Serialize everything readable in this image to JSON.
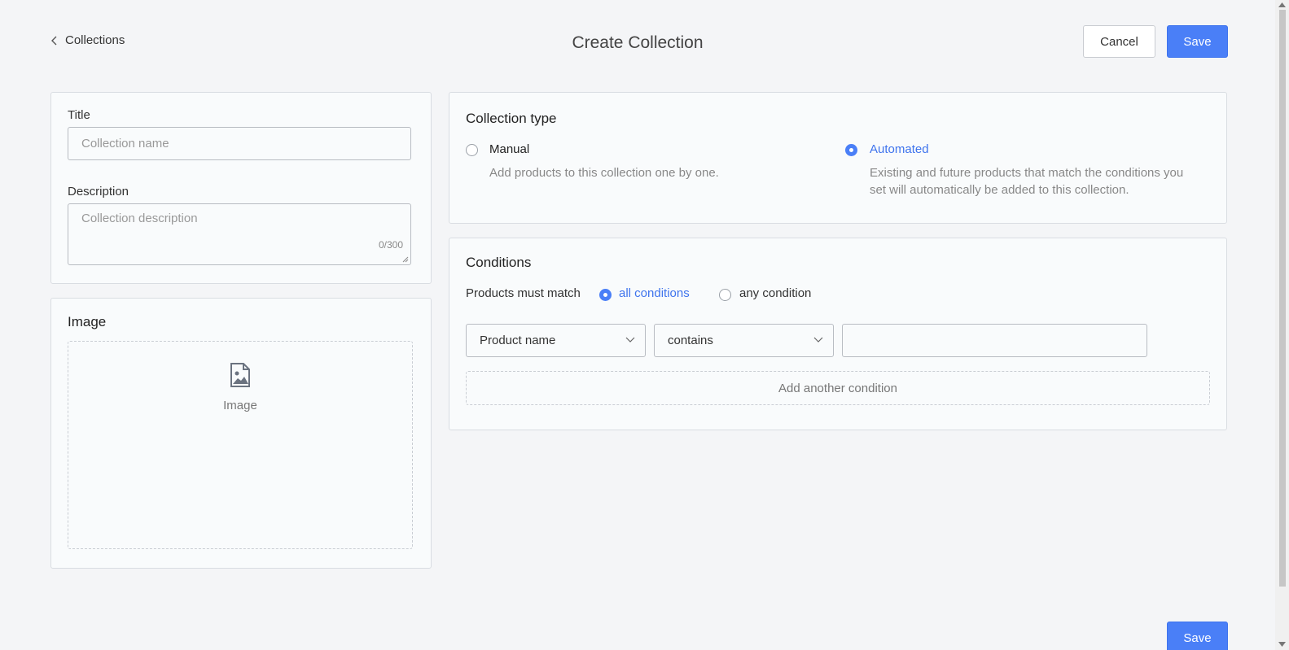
{
  "header": {
    "back_label": "Collections",
    "title": "Create Collection",
    "cancel_label": "Cancel",
    "save_label": "Save"
  },
  "info_card": {
    "title_label": "Title",
    "title_placeholder": "Collection name",
    "description_label": "Description",
    "description_placeholder": "Collection description",
    "description_counter": "0/300"
  },
  "image_card": {
    "title": "Image",
    "dropzone_label": "Image",
    "icon": "image-file-icon"
  },
  "collection_type": {
    "title": "Collection type",
    "options": [
      {
        "label": "Manual",
        "description": "Add products to this collection one by one.",
        "selected": false
      },
      {
        "label": "Automated",
        "description_lines": [
          "Existing and future products that match the conditions you",
          "set will automatically be added to this collection."
        ],
        "selected": true
      }
    ]
  },
  "conditions": {
    "title": "Conditions",
    "match_label": "Products must match",
    "match_options": [
      {
        "label": "all conditions",
        "selected": true
      },
      {
        "label": "any condition",
        "selected": false
      }
    ],
    "rule": {
      "field": "Product name",
      "operator": "contains",
      "value": ""
    },
    "add_label": "Add another condition"
  },
  "footer": {
    "save_label": "Save"
  },
  "colors": {
    "accent": "#4a7ff7",
    "background": "#f4f5f7",
    "card": "#f9fbfc"
  }
}
